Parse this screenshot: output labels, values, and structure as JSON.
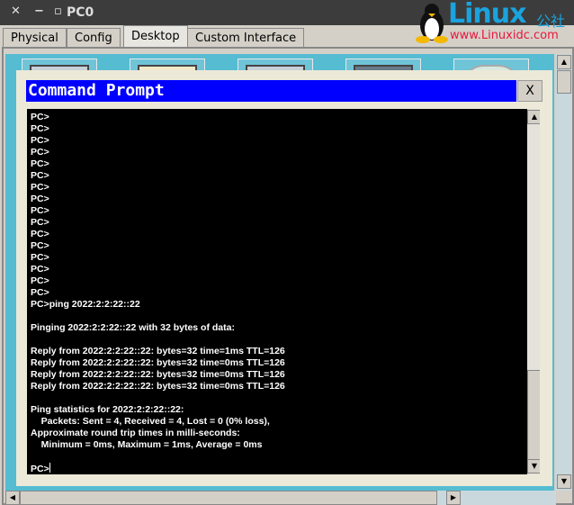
{
  "window": {
    "title": "PC0",
    "close": "✕",
    "minimize": "−",
    "maximize": "▫"
  },
  "watermark": {
    "brand": "Linux",
    "brand_cn": "公社",
    "url": "www.Linuxidc.com"
  },
  "tabs": [
    {
      "label": "Physical"
    },
    {
      "label": "Config"
    },
    {
      "label": "Desktop",
      "active": true
    },
    {
      "label": "Custom Interface"
    }
  ],
  "dialog": {
    "title": "Command Prompt",
    "close_label": "X"
  },
  "terminal": {
    "lines": [
      "PC>",
      "PC>",
      "PC>",
      "PC>",
      "PC>",
      "PC>",
      "PC>",
      "PC>",
      "PC>",
      "PC>",
      "PC>",
      "PC>",
      "PC>",
      "PC>",
      "PC>",
      "PC>",
      "PC>ping 2022:2:2:22::22",
      "",
      "Pinging 2022:2:2:22::22 with 32 bytes of data:",
      "",
      "Reply from 2022:2:2:22::22: bytes=32 time=1ms TTL=126",
      "Reply from 2022:2:2:22::22: bytes=32 time=0ms TTL=126",
      "Reply from 2022:2:2:22::22: bytes=32 time=0ms TTL=126",
      "Reply from 2022:2:2:22::22: bytes=32 time=0ms TTL=126",
      "",
      "Ping statistics for 2022:2:2:22::22:",
      "    Packets: Sent = 4, Received = 4, Lost = 0 (0% loss),",
      "Approximate round trip times in milli-seconds:",
      "    Minimum = 0ms, Maximum = 1ms, Average = 0ms",
      ""
    ],
    "prompt": "PC>"
  }
}
